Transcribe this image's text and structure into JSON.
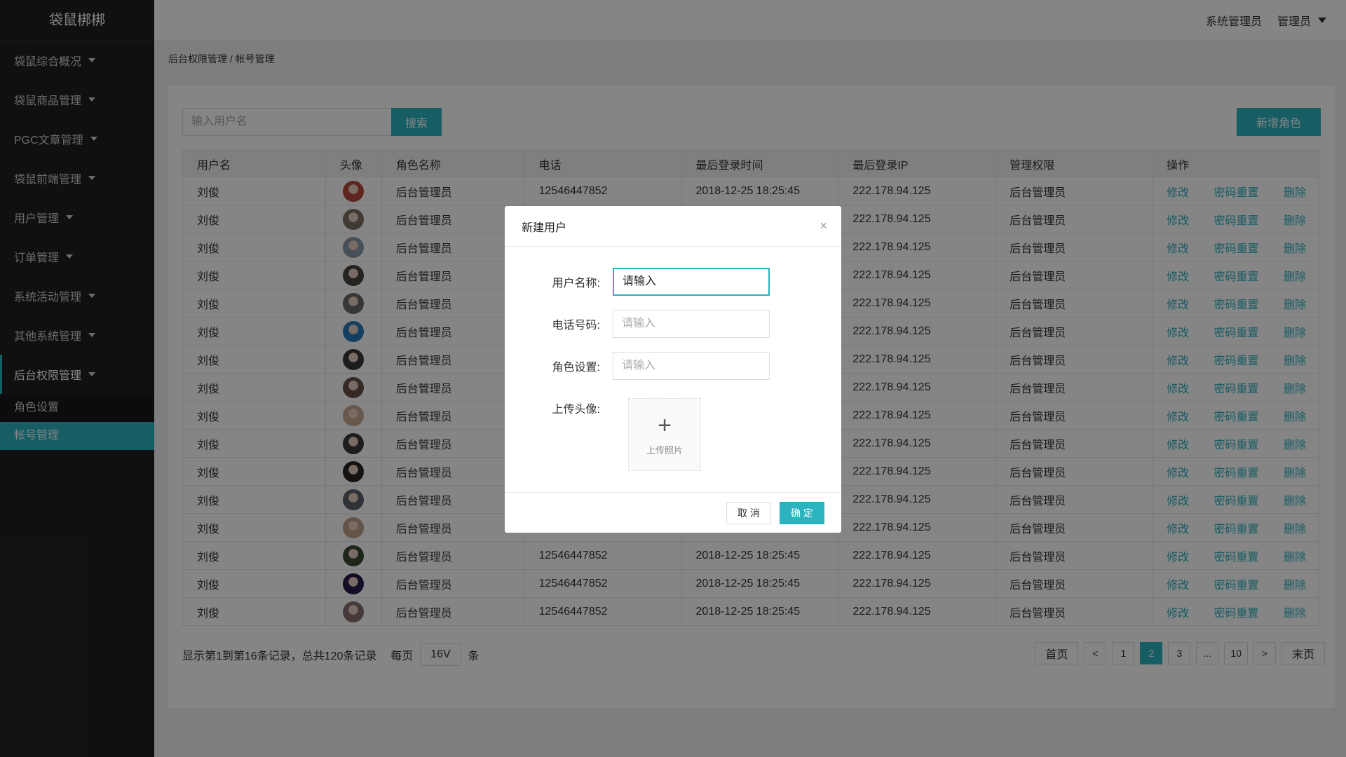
{
  "app": {
    "title": "袋鼠梆梆"
  },
  "sidebar": {
    "items": [
      {
        "label": "袋鼠综合概况"
      },
      {
        "label": "袋鼠商品管理"
      },
      {
        "label": "PGC文章管理"
      },
      {
        "label": "袋鼠前端管理"
      },
      {
        "label": "用户管理"
      },
      {
        "label": "订单管理"
      },
      {
        "label": "系统活动管理"
      },
      {
        "label": "其他系统管理"
      },
      {
        "label": "后台权限管理"
      }
    ],
    "subitems": [
      {
        "label": "角色设置"
      },
      {
        "label": "帐号管理"
      }
    ]
  },
  "topbar": {
    "role": "系统管理员",
    "user": "管理员"
  },
  "breadcrumb": "后台权限管理 / 帐号管理",
  "search": {
    "placeholder": "输入用户名",
    "button": "搜索"
  },
  "add_button": "新增角色",
  "table": {
    "headers": [
      "用户名",
      "头像",
      "角色名称",
      "电话",
      "最后登录时间",
      "最后登录IP",
      "管理权限",
      "操作"
    ],
    "row": {
      "name": "刘俊",
      "role": "后台管理员",
      "phone": "12546447852",
      "time": "2018-12-25 18:25:45",
      "ip": "222.178.94.125",
      "perm": "后台管理员"
    },
    "ops": [
      "修改",
      "密码重置",
      "删除"
    ],
    "avatar_colors": [
      "#b44a3c",
      "#7a7060",
      "#8a9aa8",
      "#4a4540",
      "#6a6a6a",
      "#2a7ab8",
      "#3a3838",
      "#6a5048",
      "#c8a890",
      "#3a3a3a",
      "#2a2624",
      "#5a6068",
      "#c0a088",
      "#3a4a30",
      "#2a1a4a",
      "#8a7070"
    ]
  },
  "footer": {
    "summary": "显示第1到第16条记录，总共120条记录",
    "per_page_label": "每页",
    "per_page_value": "16V",
    "per_page_unit": "条"
  },
  "pagination": {
    "first": "首页",
    "prev": "<",
    "pages": [
      "1",
      "2",
      "3",
      "...",
      "10"
    ],
    "active": "2",
    "next": ">",
    "last": "末页"
  },
  "modal": {
    "title": "新建用户",
    "close": "×",
    "fields": [
      {
        "label": "用户名称:",
        "placeholder": "请输入"
      },
      {
        "label": "电话号码:",
        "placeholder": "请输入"
      },
      {
        "label": "角色设置:",
        "placeholder": "请输入"
      }
    ],
    "upload_label": "上传头像:",
    "upload_text": "上传照片",
    "upload_plus": "+",
    "cancel": "取 消",
    "ok": "确 定"
  }
}
